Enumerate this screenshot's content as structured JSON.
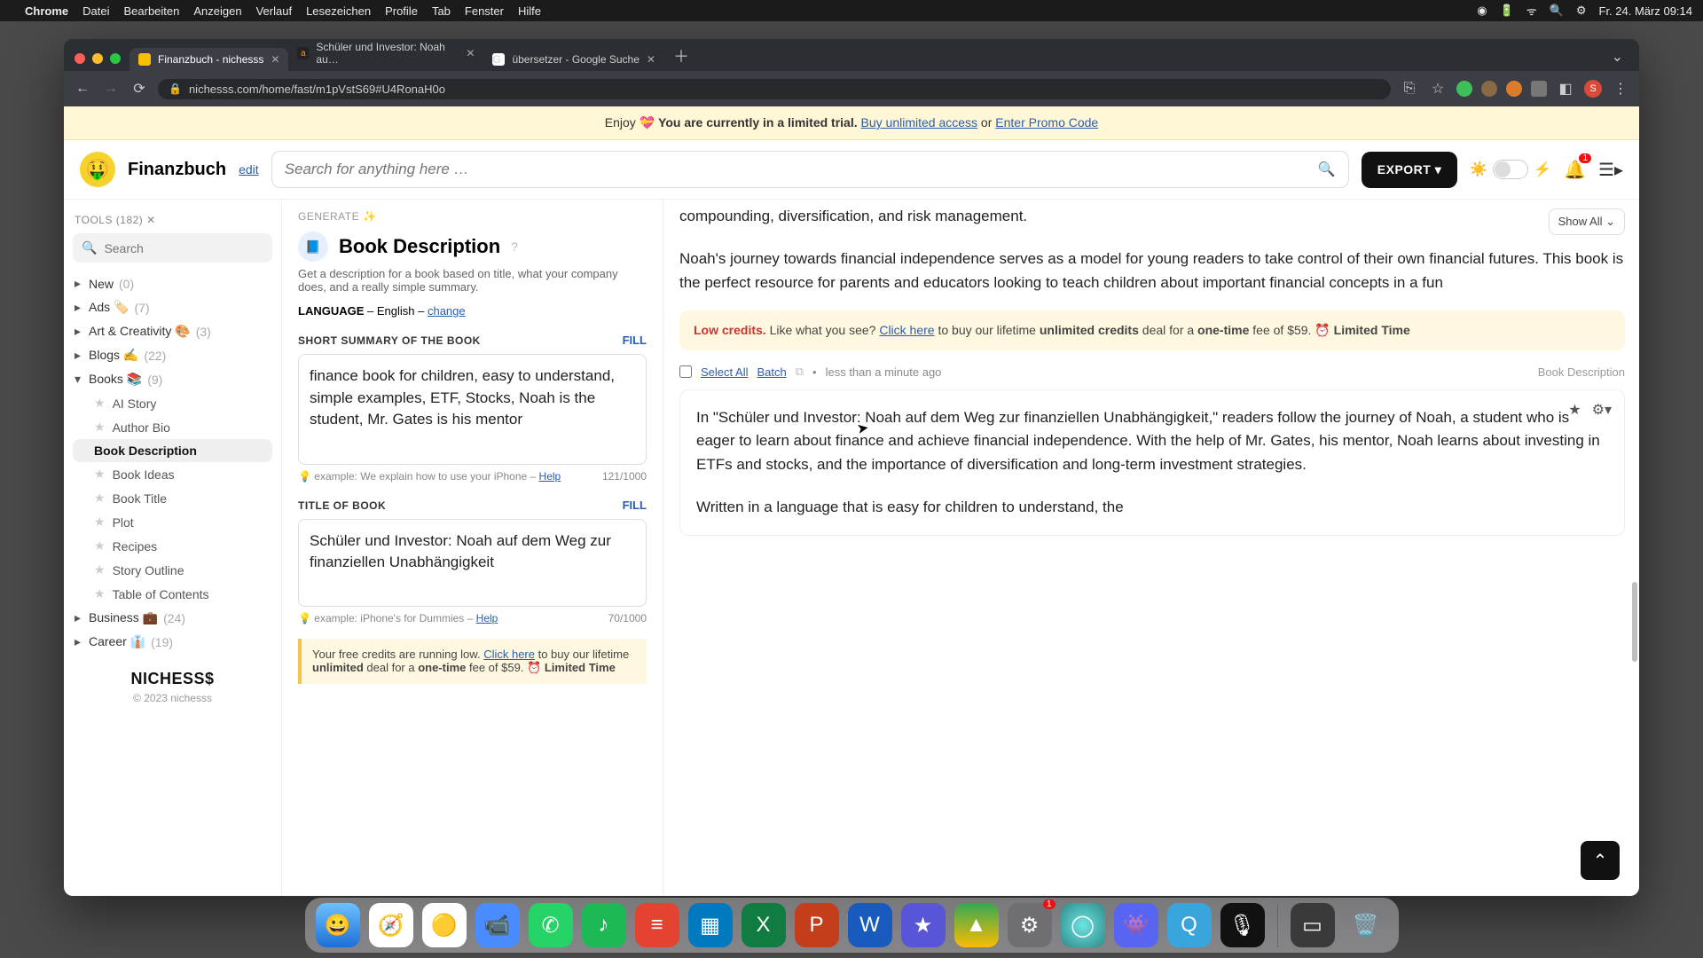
{
  "menubar": {
    "app": "Chrome",
    "items": [
      "Datei",
      "Bearbeiten",
      "Anzeigen",
      "Verlauf",
      "Lesezeichen",
      "Profile",
      "Tab",
      "Fenster",
      "Hilfe"
    ],
    "clock": "Fr. 24. März 09:14"
  },
  "tabs": {
    "t1": "Finanzbuch - nichesss",
    "t2": "Schüler und Investor: Noah au…",
    "t3": "übersetzer - Google Suche"
  },
  "url": "nichesss.com/home/fast/m1pVstS69#U4RonaH0o",
  "trial": {
    "enjoy": "Enjoy ",
    "bold": "You are currently in a limited trial.",
    "buy": " Buy unlimited access",
    "or": " or ",
    "promo": "Enter Promo Code"
  },
  "head": {
    "name": "Finanzbuch",
    "edit": "edit",
    "search_ph": "Search for anything here …",
    "export": "EXPORT",
    "bell_n": "1"
  },
  "side": {
    "tools": "TOOLS (182) ✕",
    "search_ph": "Search",
    "cats": {
      "new": {
        "t": "New",
        "c": "(0)"
      },
      "ads": {
        "t": "Ads 🏷️",
        "c": "(7)"
      },
      "art": {
        "t": "Art & Creativity 🎨",
        "c": "(3)"
      },
      "blogs": {
        "t": "Blogs ✍️",
        "c": "(22)"
      },
      "books": {
        "t": "Books 📚",
        "c": "(9)"
      },
      "biz": {
        "t": "Business 💼",
        "c": "(24)"
      },
      "career": {
        "t": "Career 👔",
        "c": "(19)"
      }
    },
    "subs": {
      "ai": "AI Story",
      "bio": "Author Bio",
      "desc": "Book Description",
      "ideas": "Book Ideas",
      "title": "Book Title",
      "plot": "Plot",
      "rec": "Recipes",
      "out": "Story Outline",
      "toc": "Table of Contents"
    },
    "brand": "NICHESS$",
    "copy": "© 2023 nichesss"
  },
  "mid": {
    "gen": "GENERATE ✨",
    "toolname": "Book Description",
    "tooldesc": "Get a description for a book based on title, what your company does, and a really simple summary.",
    "lang_label": "LANGUAGE",
    "lang_value": "English",
    "change": "change",
    "f1": "SHORT SUMMARY OF THE BOOK",
    "f2": "TITLE OF BOOK",
    "fill": "FILL",
    "summary": "finance book for children, easy to understand, simple examples, ETF, Stocks, Noah is the student, Mr. Gates is his mentor",
    "summary_ex_pre": "💡 example: We explain how to use your iPhone – ",
    "summary_help": "Help",
    "summary_cnt": "121/1000",
    "title": "Schüler und Investor: Noah auf dem Weg zur finanziellen Unabhängigkeit",
    "title_ex_pre": "💡 example: iPhone's for Dummies – ",
    "title_help": "Help",
    "title_cnt": "70/1000",
    "low_pre": "Your free credits are running low. ",
    "low_click": "Click here",
    "low_mid": " to buy our lifetime ",
    "low_bold1": "unlimited",
    "low_mid2": " deal for a ",
    "low_bold2": "one-time",
    "low_end": " fee of $59. ⏰ ",
    "low_lt": "Limited Time"
  },
  "res": {
    "showall": "Show All",
    "p1": "compounding, diversification, and risk management.",
    "p2": "Noah's journey towards financial independence serves as a model for young readers to take control of their own financial futures. This book is the perfect resource for parents and educators looking to teach children about important financial concepts in a fun",
    "wide_low_red": "Low credits.",
    "wide_low_a": " Like what you see? ",
    "wide_low_click": "Click here",
    "wide_low_b": " to buy our lifetime ",
    "wide_low_bold1": "unlimited credits",
    "wide_low_c": " deal for a ",
    "wide_low_bold2": "one-time",
    "wide_low_d": " fee of $59. ⏰ ",
    "wide_low_lt": "Limited Time",
    "selectall": "Select All",
    "batch": "Batch",
    "time": "less than a minute ago",
    "toolref": "Book Description",
    "card": "In \"Schüler und Investor: Noah auf dem Weg zur finanziellen Unabhängigkeit,\" readers follow the journey of Noah, a student who is eager to learn about finance and achieve financial independence. With the help of Mr. Gates, his mentor, Noah learns about investing in ETFs and stocks, and the importance of diversification and long-term investment strategies.",
    "card2": "Written in a language that is easy for children to understand, the"
  },
  "dock": [
    "Finder",
    "Safari",
    "Chrome",
    "Zoom",
    "WhatsApp",
    "Spotify",
    "Todoist",
    "Trello",
    "Excel",
    "PowerPoint",
    "Word",
    "iMovie",
    "Drive",
    "Settings",
    "Siri",
    "Discord",
    "QuickTime",
    "Voice",
    "Window",
    "Trash"
  ],
  "colors": {
    "accent": "#2a5db0",
    "warn": "#fff7d6"
  }
}
